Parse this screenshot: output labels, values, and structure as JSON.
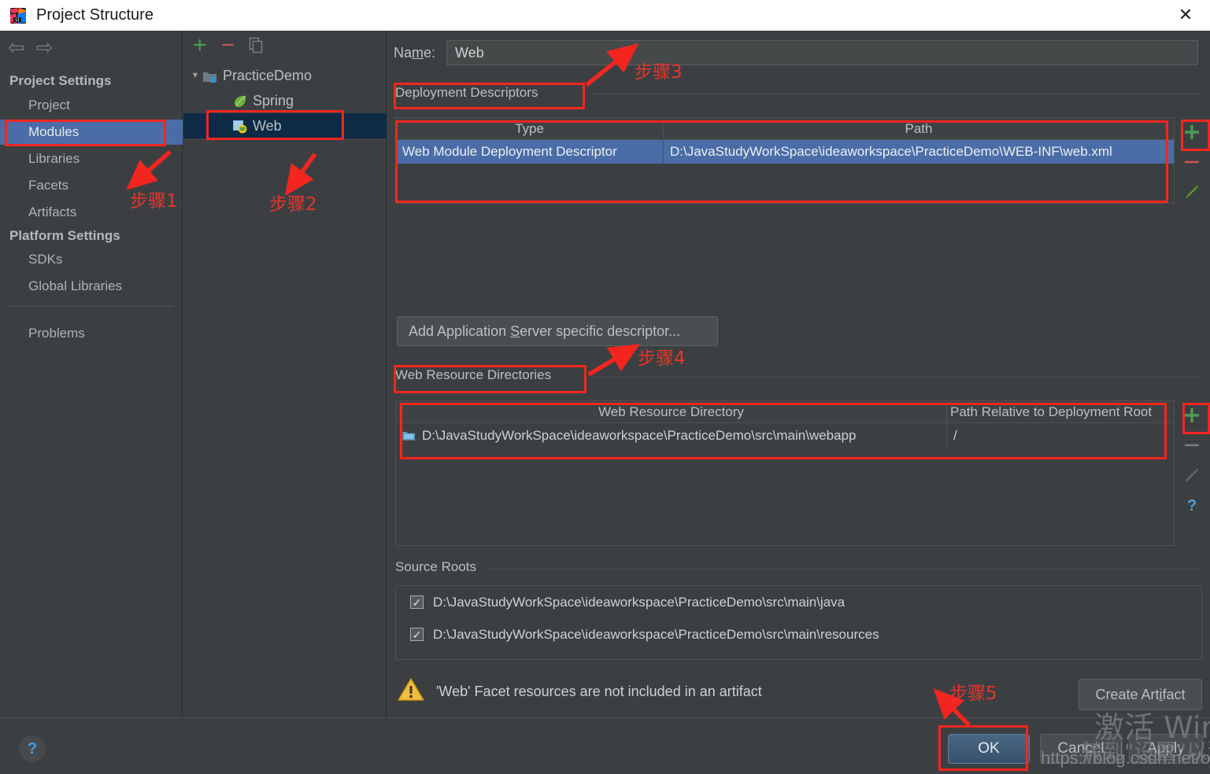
{
  "window": {
    "title": "Project Structure",
    "close_label": "✕",
    "app_icon": "intellij-idea-icon"
  },
  "sidebar": {
    "nav_back": "⇦",
    "nav_forward": "⇨",
    "groups": [
      {
        "title": "Project Settings",
        "items": [
          {
            "label": "Project",
            "selected": false
          },
          {
            "label": "Modules",
            "selected": true
          },
          {
            "label": "Libraries",
            "selected": false
          },
          {
            "label": "Facets",
            "selected": false
          },
          {
            "label": "Artifacts",
            "selected": false
          }
        ]
      },
      {
        "title": "Platform Settings",
        "items": [
          {
            "label": "SDKs",
            "selected": false
          },
          {
            "label": "Global Libraries",
            "selected": false
          }
        ]
      }
    ],
    "problems_label": "Problems",
    "help_label": "?"
  },
  "tree": {
    "toolbar": {
      "add": "+",
      "remove": "−",
      "copy": "copy-icon"
    },
    "nodes": [
      {
        "label": "PracticeDemo",
        "icon": "module-folder-icon",
        "selected": false,
        "expanded": true,
        "depth": 0
      },
      {
        "label": "Spring",
        "icon": "spring-leaf-icon",
        "selected": false,
        "depth": 1
      },
      {
        "label": "Web",
        "icon": "web-facet-icon",
        "selected": true,
        "depth": 1
      }
    ]
  },
  "main": {
    "name_label": "Name:",
    "name_value": "Web",
    "deployment_descriptors": {
      "title": "Deployment Descriptors",
      "columns": [
        "Type",
        "Path"
      ],
      "rows": [
        {
          "type": "Web Module Deployment Descriptor",
          "path": "D:\\JavaStudyWorkSpace\\ideaworkspace\\PracticeDemo\\WEB-INF\\web.xml",
          "selected": true
        }
      ],
      "tools": [
        "add-icon",
        "remove-icon",
        "edit-pencil-icon"
      ]
    },
    "add_descriptor_button": "Add Application Server specific descriptor...",
    "web_resource_directories": {
      "title": "Web Resource Directories",
      "columns": [
        "Web Resource Directory",
        "Path Relative to Deployment Root"
      ],
      "rows": [
        {
          "directory": "D:\\JavaStudyWorkSpace\\ideaworkspace\\PracticeDemo\\src\\main\\webapp",
          "relative_path": "/",
          "icon": "folder-icon"
        }
      ],
      "tools": [
        "add-icon",
        "remove-icon",
        "edit-pencil-icon",
        "help-icon"
      ]
    },
    "source_roots": {
      "title": "Source Roots",
      "items": [
        {
          "path": "D:\\JavaStudyWorkSpace\\ideaworkspace\\PracticeDemo\\src\\main\\java",
          "checked": true
        },
        {
          "path": "D:\\JavaStudyWorkSpace\\ideaworkspace\\PracticeDemo\\src\\main\\resources",
          "checked": true
        }
      ]
    },
    "warning": {
      "icon": "warning-triangle-icon",
      "text": "'Web' Facet resources are not included in an artifact"
    },
    "create_artifact_button": "Create Artifact"
  },
  "footer": {
    "ok": "OK",
    "cancel": "Cancel",
    "apply": "Apply"
  },
  "annotations": {
    "step1": "步骤1",
    "step2": "步骤2",
    "step3": "步骤3",
    "step4": "步骤4",
    "step5": "步骤5",
    "color": "#f3261f"
  },
  "watermarks": {
    "windows_line1": "激活 Wind",
    "windows_line2": "转到\"设置\"以激",
    "csdn": "https://blog.csdn.net/outdata"
  },
  "colors": {
    "selection_blue": "#4a6da7",
    "tree_selection": "#0d2b45",
    "background": "#3c3f41",
    "accent_green": "#499c54",
    "accent_red": "#c75450",
    "annotation_red": "#f3261f"
  }
}
